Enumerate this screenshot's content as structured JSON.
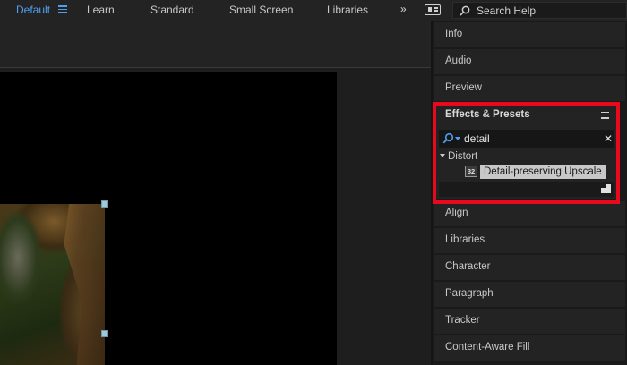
{
  "workspaces": {
    "items": [
      "Default",
      "Learn",
      "Standard",
      "Small Screen",
      "Libraries"
    ],
    "active": "Default",
    "overflow_glyph": "»"
  },
  "help_search": {
    "placeholder": "Search Help"
  },
  "panels": {
    "top_tabs": [
      "Info",
      "Audio",
      "Preview"
    ],
    "bottom_tabs": [
      "Align",
      "Libraries",
      "Character",
      "Paragraph",
      "Tracker",
      "Content-Aware Fill"
    ]
  },
  "effects_presets": {
    "title": "Effects & Presets",
    "search_value": "detail",
    "clear_glyph": "✕",
    "category": "Distort",
    "effect_badge": "32",
    "effect_name": "Detail-preserving Upscale"
  },
  "colors": {
    "accent_blue": "#4f9ff0",
    "highlight_red": "#e8091d"
  },
  "icons": {
    "workspace_menu": "hamburger-menu-icon",
    "workspace_layout": "workspace-layout-icon",
    "search": "search-icon",
    "panel_menu": "panel-menu-icon",
    "new_bin": "new-bin-icon"
  }
}
